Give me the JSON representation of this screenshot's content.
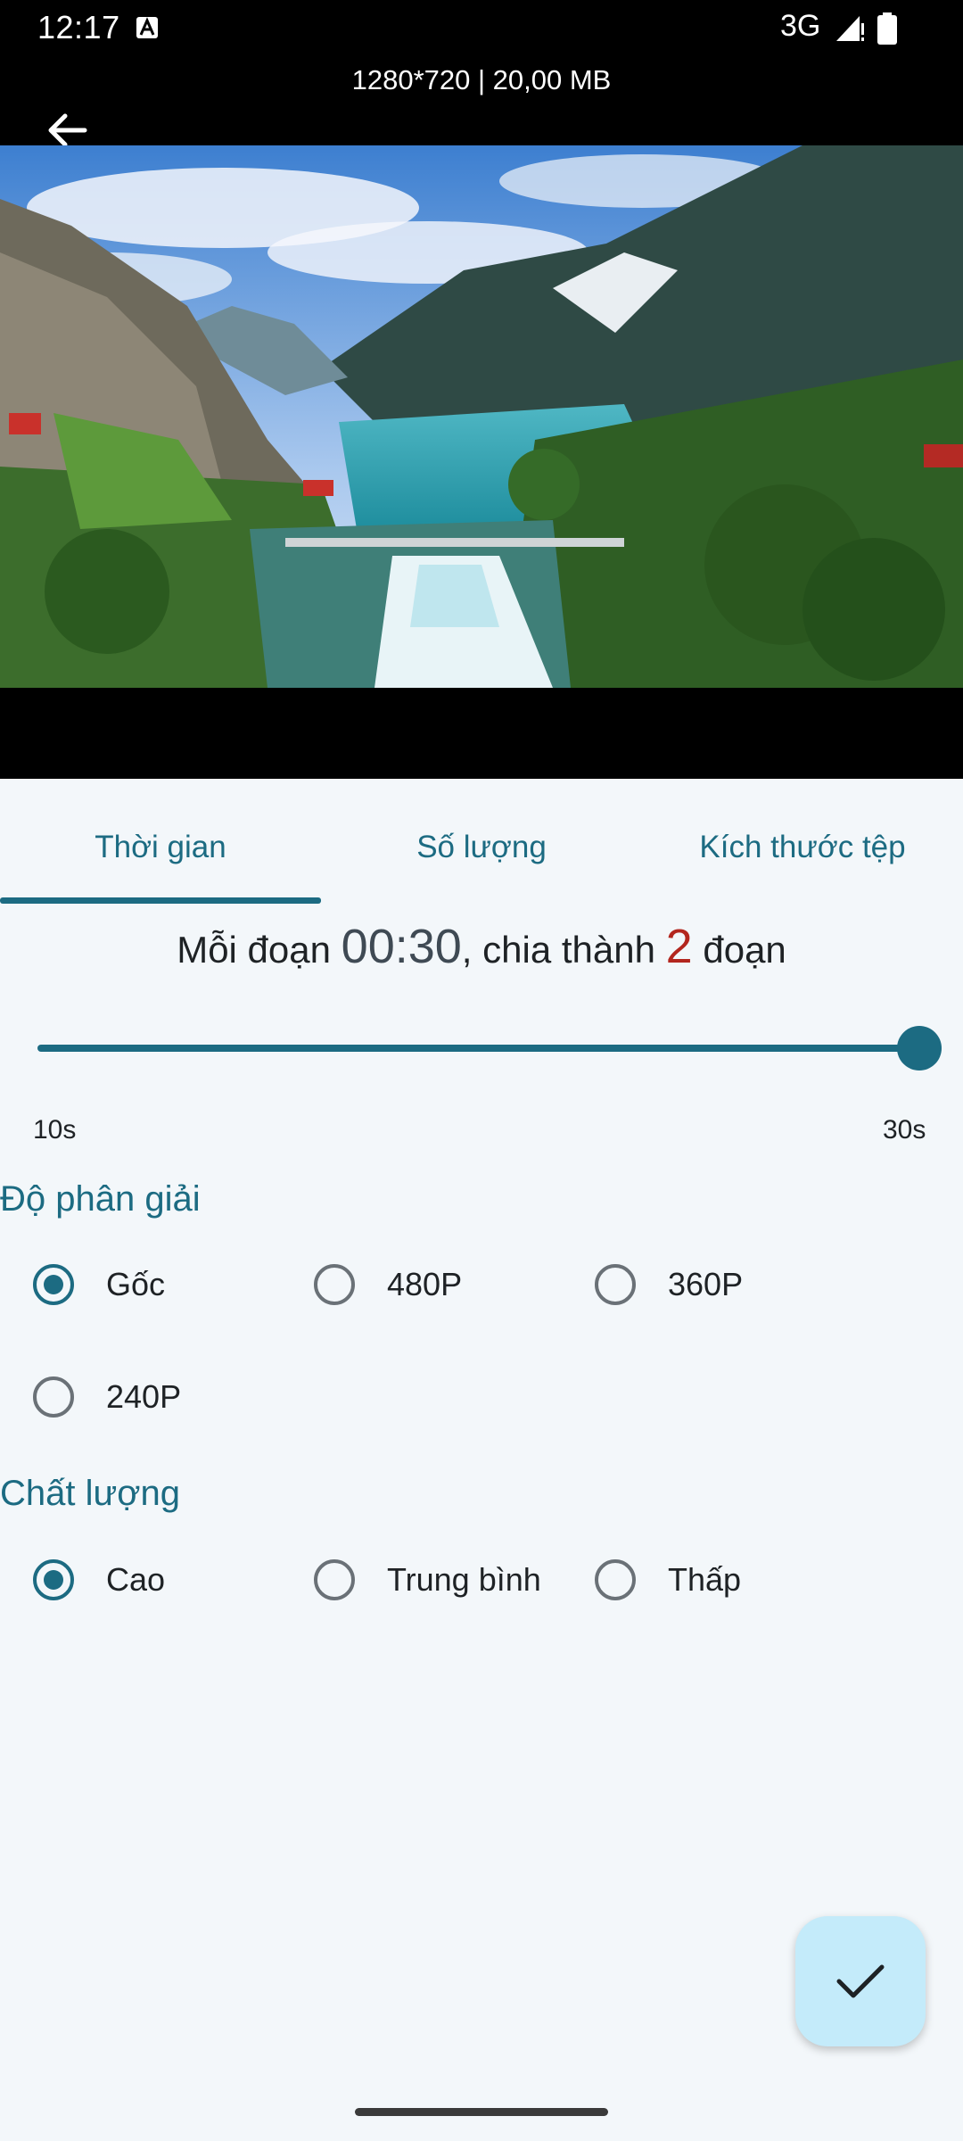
{
  "status_bar": {
    "time": "12:17",
    "network": "3G"
  },
  "video": {
    "info": "1280*720 | 20,00 MB"
  },
  "tabs": [
    {
      "label": "Thời gian",
      "selected": true
    },
    {
      "label": "Số lượng",
      "selected": false
    },
    {
      "label": "Kích thước tệp",
      "selected": false
    }
  ],
  "segment": {
    "prefix": "Mỗi đoạn",
    "duration": "00:30",
    "middle": ", chia thành",
    "count": "2",
    "suffix": "đoạn"
  },
  "slider": {
    "min_label": "10s",
    "max_label": "30s",
    "min_seconds": 10,
    "max_seconds": 30,
    "value_seconds": 30
  },
  "resolution": {
    "title": "Độ phân giải",
    "options": [
      {
        "label": "Gốc",
        "checked": true
      },
      {
        "label": "480P",
        "checked": false
      },
      {
        "label": "360P",
        "checked": false
      },
      {
        "label": "240P",
        "checked": false
      }
    ]
  },
  "quality": {
    "title": "Chất lượng",
    "options": [
      {
        "label": "Cao",
        "checked": true
      },
      {
        "label": "Trung bình",
        "checked": false
      },
      {
        "label": "Thấp",
        "checked": false
      }
    ]
  },
  "colors": {
    "accent": "#1c6b82",
    "count_highlight": "#b3261e",
    "fab_background": "#c4ebfa",
    "page_background": "#f3f7fa"
  },
  "icons": {
    "back": "arrow-left-icon",
    "confirm": "check-icon"
  }
}
